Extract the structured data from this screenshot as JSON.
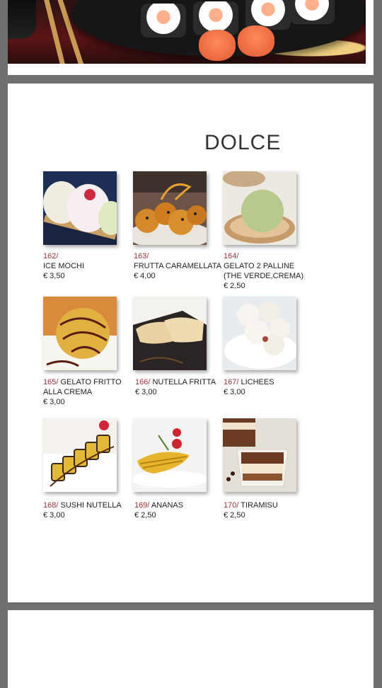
{
  "menu": {
    "title": "DOLCE",
    "items": [
      {
        "number": "162/",
        "name": "ICE MOCHI",
        "name2": "",
        "price": "€ 3,50"
      },
      {
        "number": "163/",
        "name": "FRUTTA CARAMELLATA",
        "name2": "",
        "price": "€ 4,00"
      },
      {
        "number": "164/",
        "name": "GELATO 2 PALLINE",
        "name2": "(THE VERDE,CREMA)",
        "price": "€ 2,50"
      },
      {
        "number": "165/",
        "name": "GELATO FRITTO",
        "name2": "ALLA CREMA",
        "price": "€ 3,00"
      },
      {
        "number": "166/",
        "name": "NUTELLA FRITTA",
        "name2": "",
        "price": "€ 3,00"
      },
      {
        "number": "167/",
        "name": "LICHEES",
        "name2": "",
        "price": "€ 3,00"
      },
      {
        "number": "168/",
        "name": "SUSHI NUTELLA",
        "name2": "",
        "price": "€ 3,00"
      },
      {
        "number": "169/",
        "name": "ANANAS",
        "name2": "",
        "price": "€ 2,50"
      },
      {
        "number": "170/",
        "name": "TIRAMISU",
        "name2": "",
        "price": "€ 2,50"
      }
    ]
  },
  "colors": {
    "background": "#6f6f6f",
    "page": "#ffffff",
    "item_number": "#a2343d",
    "text": "#222222"
  }
}
